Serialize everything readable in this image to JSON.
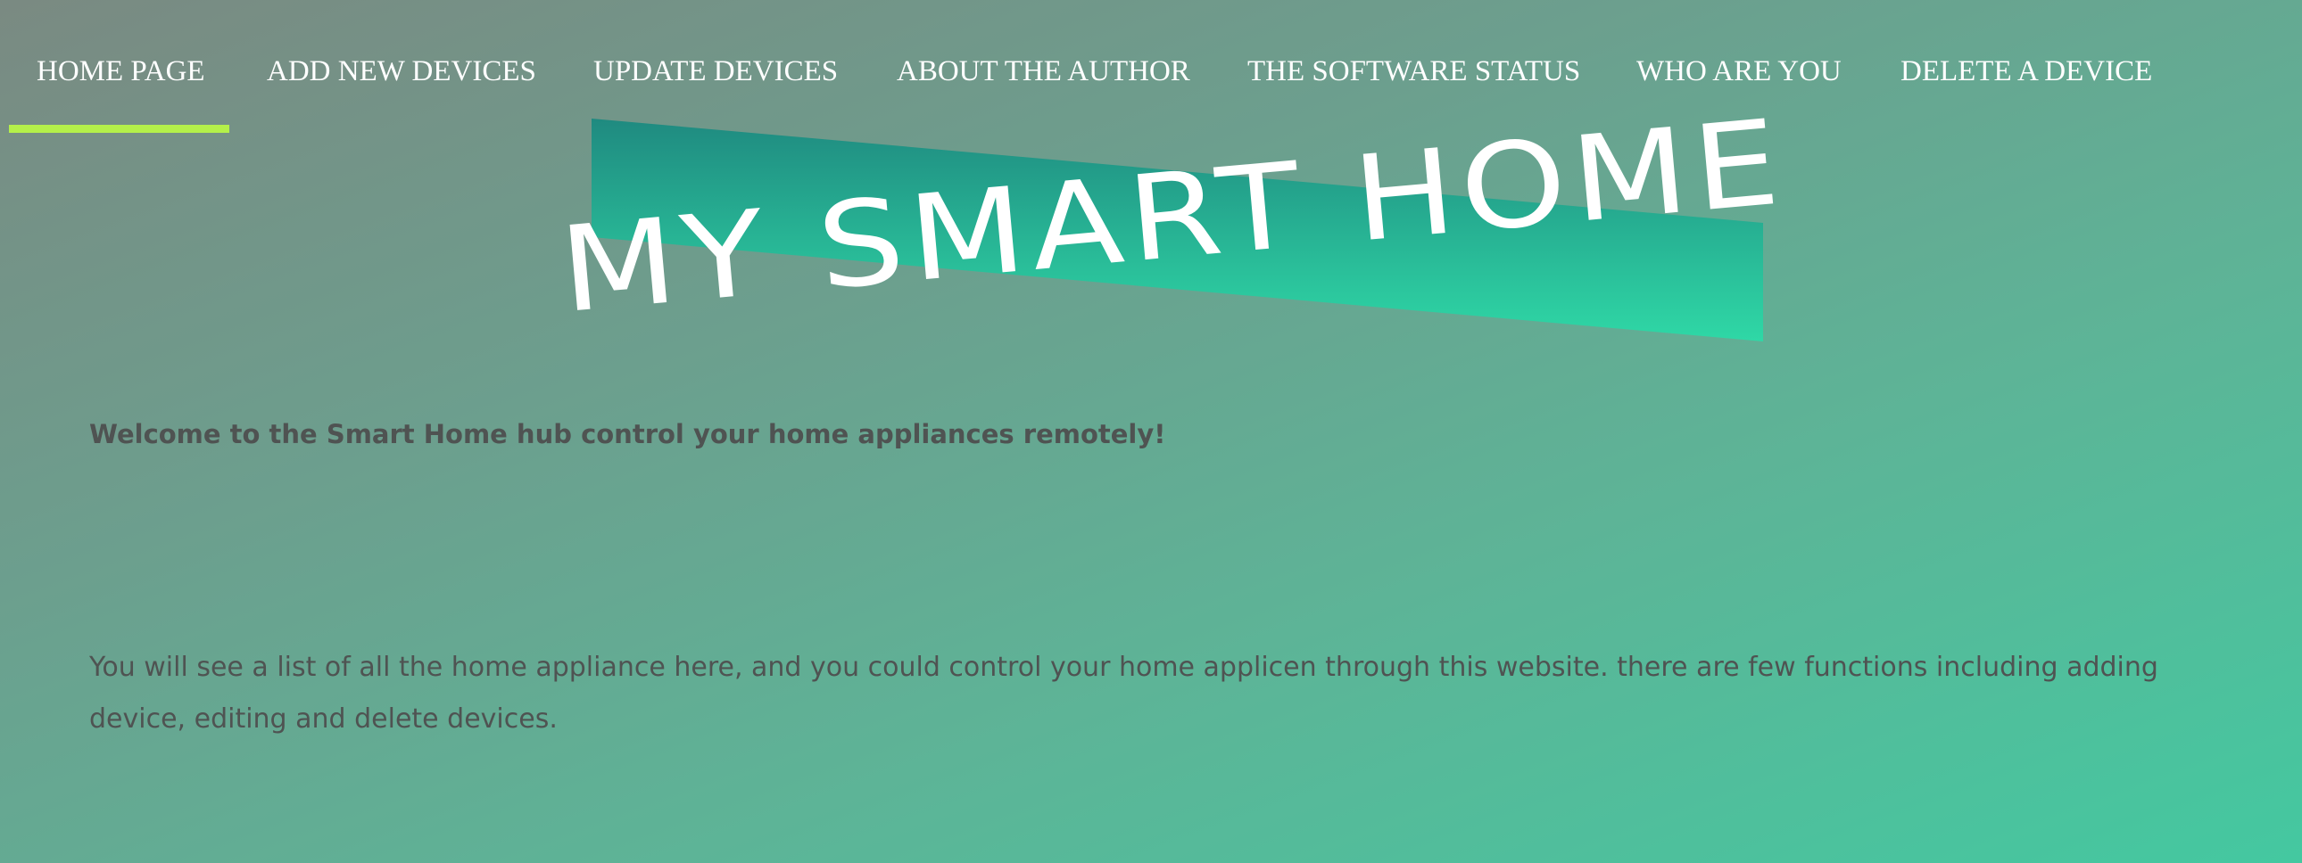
{
  "nav": {
    "items": [
      {
        "label": "HOME PAGE",
        "active": true
      },
      {
        "label": "ADD NEW DEVICES"
      },
      {
        "label": "UPDATE DEVICES"
      },
      {
        "label": "ABOUT THE AUTHOR"
      },
      {
        "label": "THE SOFTWARE STATUS"
      },
      {
        "label": "WHO ARE YOU"
      },
      {
        "label": "DELETE A DEVICE"
      }
    ],
    "active_color": "#b4f04a"
  },
  "banner": {
    "title": "MY SMART HOME",
    "gradient_top": "#1f8a80",
    "gradient_bottom": "#2fd8a6"
  },
  "welcome": {
    "text": "Welcome to the Smart Home hub control your home appliances remotely!"
  },
  "description": {
    "text": "You will see a list of all the home appliance here, and you could control your home applicen through this website. there are few functions including adding device, editing and delete devices."
  }
}
